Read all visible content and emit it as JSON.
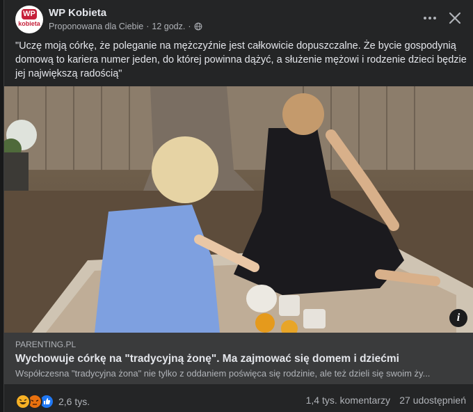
{
  "post": {
    "page_name": "WP Kobieta",
    "avatar_line1": "WP",
    "avatar_line2": "kobieta",
    "suggested": "Proponowana dla Ciebie",
    "time": "12 godz.",
    "separator": "·",
    "privacy_icon": "globe-icon",
    "text": "\"Uczę moją córkę, że poleganie na mężczyźnie jest całkowicie dopuszczalne. Że bycie gospodynią domową to kariera numer jeden, do której powinna dążyć, a służenie mężowi i rodzenie dzieci będzie jej największą radością\""
  },
  "link": {
    "domain": "PARENTING.PL",
    "title": "Wychowuje córkę na \"tradycyjną żonę\". Ma zajmować się domem i dziećmi",
    "description": "Współczesna \"tradycyjna żona\" nie tylko z oddaniem poświęca się rodzinie, ale też dzieli się swoim ży..."
  },
  "media": {
    "info_label": "i"
  },
  "footer": {
    "reactions": [
      "haha",
      "angry",
      "like"
    ],
    "reaction_count": "2,6 tys.",
    "comments": "1,4 tys. komentarzy",
    "shares": "27 udostępnień"
  },
  "colors": {
    "background": "#242526",
    "link_box": "#3a3b3c",
    "text_primary": "#e4e6eb",
    "text_secondary": "#b0b3b8",
    "brand": "#c6203a"
  }
}
